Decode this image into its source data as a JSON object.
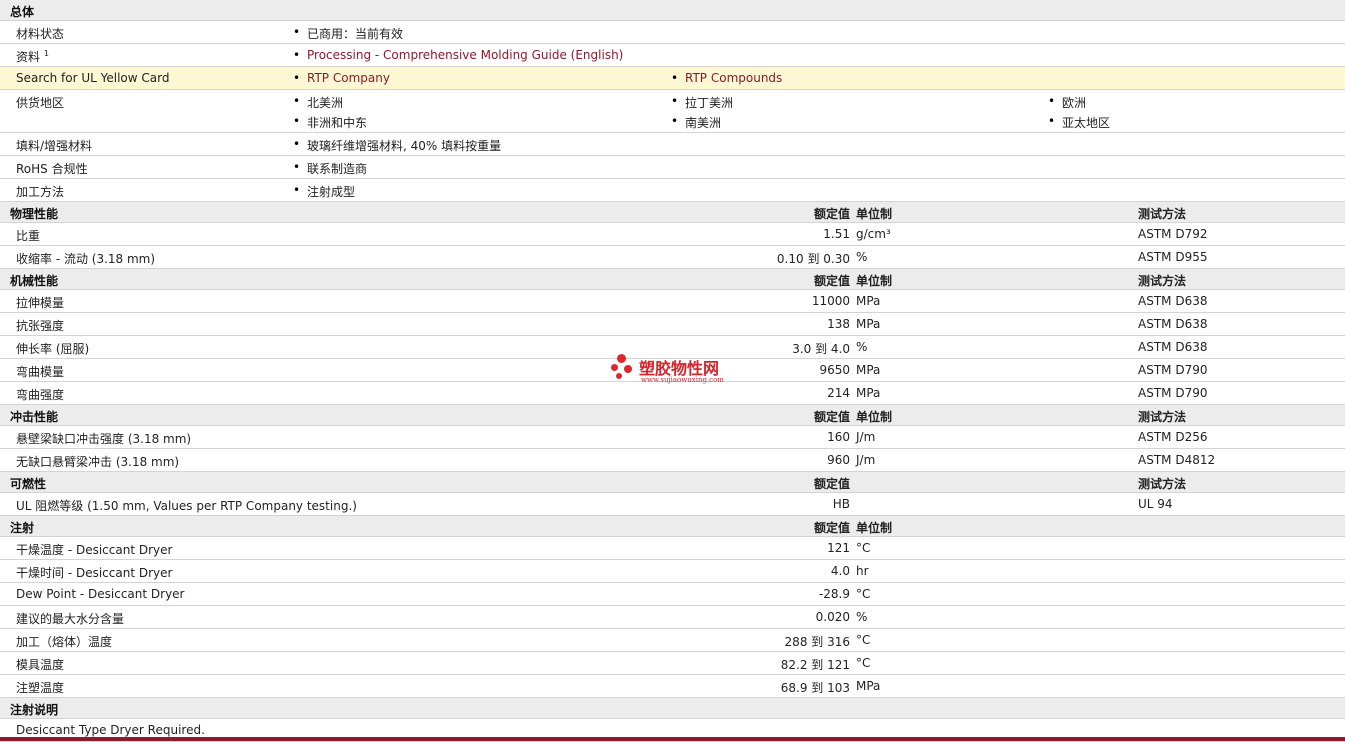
{
  "general": {
    "title": "总体",
    "material_status": {
      "label": "材料状态",
      "value": "已商用：当前有效"
    },
    "resources": {
      "label": "资料",
      "sup": "1",
      "value": "Processing - Comprehensive Molding Guide (English)"
    },
    "yellow_card": {
      "label": "Search for UL Yellow Card",
      "items": [
        "RTP Company",
        "RTP Compounds"
      ]
    },
    "regions": {
      "label": "供货地区",
      "items": [
        "北美洲",
        "拉丁美洲",
        "欧洲",
        "非洲和中东",
        "南美洲",
        "亚太地区"
      ]
    },
    "filler": {
      "label": "填料/增强材料",
      "value": "玻璃纤维增强材料, 40% 填料按重量"
    },
    "rohs": {
      "label": "RoHS 合规性",
      "value": "联系制造商"
    },
    "processing": {
      "label": "加工方法",
      "value": "注射成型"
    }
  },
  "col_headers": {
    "value": "额定值",
    "unit": "单位制",
    "method": "测试方法"
  },
  "sections": {
    "physical": {
      "title": "物理性能",
      "rows": [
        {
          "label": "比重",
          "value": "1.51",
          "unit": "g/cm³",
          "method": "ASTM D792"
        },
        {
          "label": "收缩率  - 流动  (3.18 mm)",
          "value": "0.10 到  0.30",
          "unit": "%",
          "method": "ASTM D955"
        }
      ]
    },
    "mechanical": {
      "title": "机械性能",
      "rows": [
        {
          "label": "拉伸模量",
          "value": "11000",
          "unit": "MPa",
          "method": "ASTM D638"
        },
        {
          "label": "抗张强度",
          "value": "138",
          "unit": "MPa",
          "method": "ASTM D638"
        },
        {
          "label": "伸长率  (屈服)",
          "value": "3.0 到  4.0",
          "unit": "%",
          "method": "ASTM D638"
        },
        {
          "label": "弯曲模量",
          "value": "9650",
          "unit": "MPa",
          "method": "ASTM D790"
        },
        {
          "label": "弯曲强度",
          "value": "214",
          "unit": "MPa",
          "method": "ASTM D790"
        }
      ]
    },
    "impact": {
      "title": "冲击性能",
      "rows": [
        {
          "label": "悬壁梁缺口冲击强度  (3.18 mm)",
          "value": "160",
          "unit": "J/m",
          "method": "ASTM D256"
        },
        {
          "label": "无缺口悬臂梁冲击  (3.18 mm)",
          "value": "960",
          "unit": "J/m",
          "method": "ASTM D4812"
        }
      ]
    },
    "flammability": {
      "title": "可燃性",
      "rows": [
        {
          "label": "UL 阻燃等级  (1.50 mm, Values per RTP Company testing.)",
          "value": "HB",
          "unit": "",
          "method": "UL 94"
        }
      ]
    },
    "injection": {
      "title": "注射",
      "rows": [
        {
          "label": "干燥温度  - Desiccant Dryer",
          "value": "121",
          "unit": "°C",
          "method": ""
        },
        {
          "label": "干燥时间  - Desiccant Dryer",
          "value": "4.0",
          "unit": "hr",
          "method": ""
        },
        {
          "label": "Dew Point - Desiccant Dryer",
          "value": "-28.9",
          "unit": "°C",
          "method": ""
        },
        {
          "label": "建议的最大水分含量",
          "value": "0.020",
          "unit": "%",
          "method": ""
        },
        {
          "label": "加工（熔体）温度",
          "value": "288 到  316",
          "unit": "°C",
          "method": ""
        },
        {
          "label": "模具温度",
          "value": "82.2 到  121",
          "unit": "°C",
          "method": ""
        },
        {
          "label": "注塑温度",
          "value": "68.9 到  103",
          "unit": "MPa",
          "method": ""
        }
      ]
    },
    "injection_notes": {
      "title": "注射说明",
      "text": "Desiccant Type Dryer Required."
    }
  },
  "watermark": {
    "cn": "塑胶物性网",
    "en": "www.sujiaowuxing.com"
  },
  "colors": {
    "link": "#8b1a2b",
    "header_bg": "#ececec",
    "highlight": "#fdf8d3",
    "accent": "#8c1c2a"
  }
}
